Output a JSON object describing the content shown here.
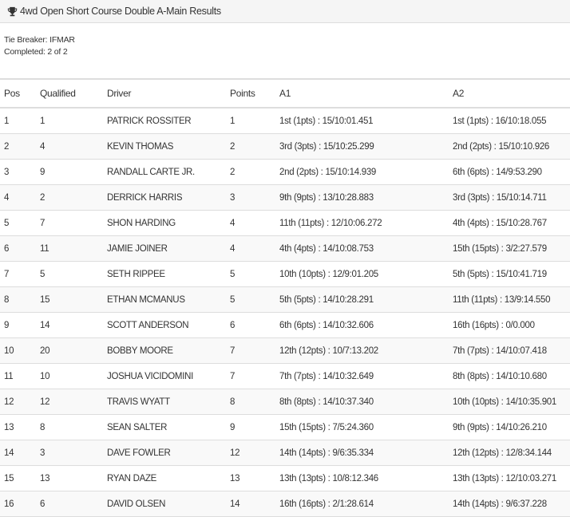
{
  "header": {
    "title": "4wd Open Short Course Double A-Main Results"
  },
  "meta": {
    "tie_breaker": "Tie Breaker: IFMAR",
    "completed": "Completed: 2 of 2"
  },
  "table": {
    "columns": [
      "Pos",
      "Qualified",
      "Driver",
      "Points",
      "A1",
      "A2"
    ],
    "rows": [
      [
        "1",
        "1",
        "PATRICK ROSSITER",
        "1",
        "1st (1pts) : 15/10:01.451",
        "1st (1pts) : 16/10:18.055"
      ],
      [
        "2",
        "4",
        "KEVIN THOMAS",
        "2",
        "3rd (3pts) : 15/10:25.299",
        "2nd (2pts) : 15/10:10.926"
      ],
      [
        "3",
        "9",
        "RANDALL CARTE JR.",
        "2",
        "2nd (2pts) : 15/10:14.939",
        "6th (6pts) : 14/9:53.290"
      ],
      [
        "4",
        "2",
        "DERRICK HARRIS",
        "3",
        "9th (9pts) : 13/10:28.883",
        "3rd (3pts) : 15/10:14.711"
      ],
      [
        "5",
        "7",
        "SHON HARDING",
        "4",
        "11th (11pts) : 12/10:06.272",
        "4th (4pts) : 15/10:28.767"
      ],
      [
        "6",
        "11",
        "JAMIE JOINER",
        "4",
        "4th (4pts) : 14/10:08.753",
        "15th (15pts) : 3/2:27.579"
      ],
      [
        "7",
        "5",
        "SETH RIPPEE",
        "5",
        "10th (10pts) : 12/9:01.205",
        "5th (5pts) : 15/10:41.719"
      ],
      [
        "8",
        "15",
        "ETHAN MCMANUS",
        "5",
        "5th (5pts) : 14/10:28.291",
        "11th (11pts) : 13/9:14.550"
      ],
      [
        "9",
        "14",
        "SCOTT ANDERSON",
        "6",
        "6th (6pts) : 14/10:32.606",
        "16th (16pts) : 0/0.000"
      ],
      [
        "10",
        "20",
        "BOBBY MOORE",
        "7",
        "12th (12pts) : 10/7:13.202",
        "7th (7pts) : 14/10:07.418"
      ],
      [
        "11",
        "10",
        "JOSHUA VICIDOMINI",
        "7",
        "7th (7pts) : 14/10:32.649",
        "8th (8pts) : 14/10:10.680"
      ],
      [
        "12",
        "12",
        "TRAVIS WYATT",
        "8",
        "8th (8pts) : 14/10:37.340",
        "10th (10pts) : 14/10:35.901"
      ],
      [
        "13",
        "8",
        "SEAN SALTER",
        "9",
        "15th (15pts) : 7/5:24.360",
        "9th (9pts) : 14/10:26.210"
      ],
      [
        "14",
        "3",
        "DAVE FOWLER",
        "12",
        "14th (14pts) : 9/6:35.334",
        "12th (12pts) : 12/8:34.144"
      ],
      [
        "15",
        "13",
        "RYAN DAZE",
        "13",
        "13th (13pts) : 10/8:12.346",
        "13th (13pts) : 12/10:03.271"
      ],
      [
        "16",
        "6",
        "DAVID OLSEN",
        "14",
        "16th (16pts) : 2/1:28.614",
        "14th (14pts) : 9/6:37.228"
      ]
    ]
  }
}
